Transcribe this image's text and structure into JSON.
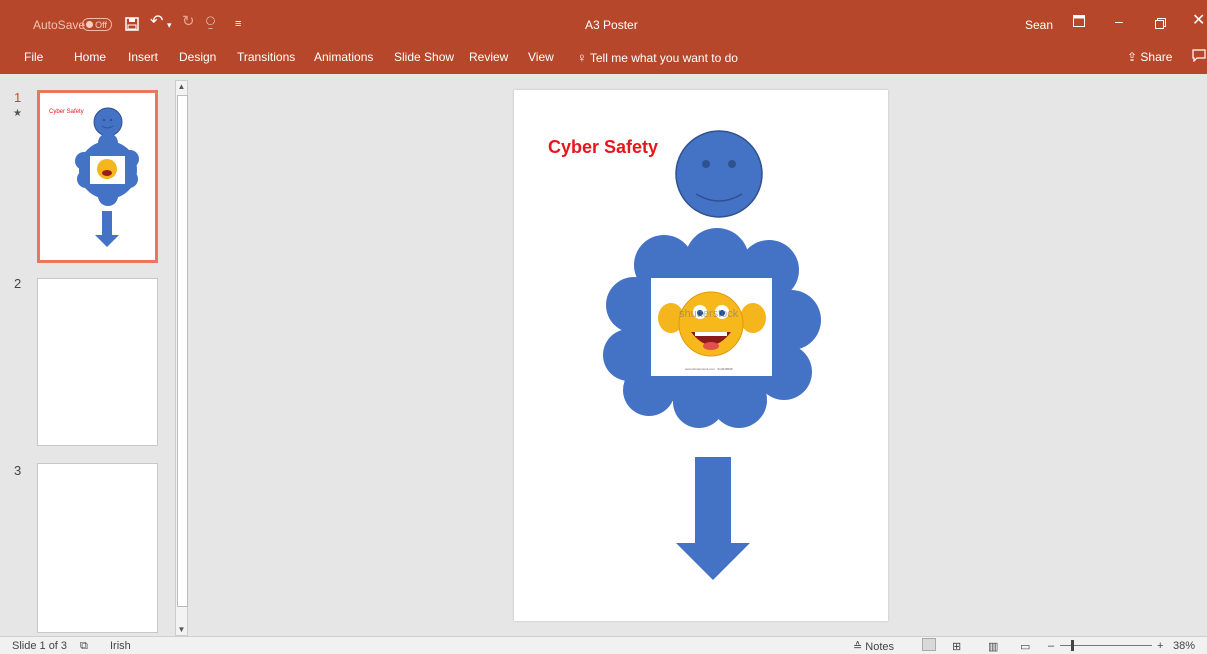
{
  "titlebar": {
    "autosave_label": "AutoSave",
    "autosave_state": "Off",
    "document_title": "A3 Poster",
    "user_name": "Sean"
  },
  "ribbon": {
    "tabs": [
      "File",
      "Home",
      "Insert",
      "Design",
      "Transitions",
      "Animations",
      "Slide Show",
      "Review",
      "View"
    ],
    "tell_me": "Tell me what you want to do",
    "share": "Share"
  },
  "thumbnails": [
    {
      "number": "1",
      "title": "Cyber Safety",
      "selected": true
    },
    {
      "number": "2"
    },
    {
      "number": "3"
    }
  ],
  "slide": {
    "title": "Cyber Safety",
    "image_watermark": "shutterstock",
    "image_caption": "www.shutterstock.com · 512648698",
    "colors": {
      "title": "#e8161b",
      "shape": "#4472c4",
      "shape_dark": "#2f528f"
    }
  },
  "statusbar": {
    "slide_info": "Slide 1 of 3",
    "language": "Irish",
    "notes": "Notes",
    "zoom": "38%"
  },
  "colors": {
    "accent": "#b7472a",
    "selected_thumb": "#e9775a"
  }
}
